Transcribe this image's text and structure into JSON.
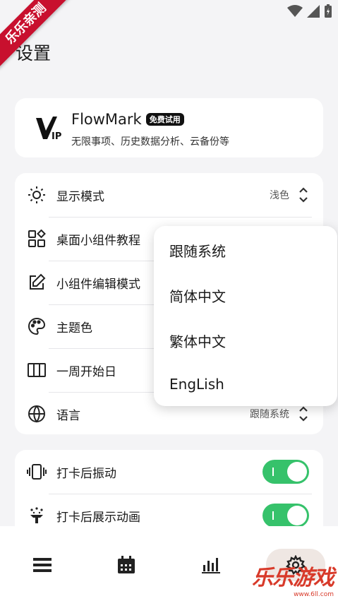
{
  "watermark": {
    "ribbon": "乐乐亲测",
    "corner_title": "乐乐游戏",
    "corner_url": "www.6ll.com"
  },
  "page": {
    "title": "设置"
  },
  "vip": {
    "name": "FlowMark",
    "badge": "免费试用",
    "desc": "无限事项、历史数据分析、云备份等",
    "logo_text": "VIP"
  },
  "settings": {
    "rows": [
      {
        "label": "显示模式",
        "value": "浅色",
        "icon": "sun-icon"
      },
      {
        "label": "桌面小组件教程",
        "icon": "widgets-icon"
      },
      {
        "label": "小组件编辑模式",
        "icon": "edit-icon"
      },
      {
        "label": "主题色",
        "icon": "palette-icon"
      },
      {
        "label": "一周开始日",
        "icon": "columns-icon"
      },
      {
        "label": "语言",
        "value": "跟随系统",
        "icon": "globe-icon"
      }
    ]
  },
  "language_menu": {
    "options": [
      "跟随系统",
      "简体中文",
      "繁体中文",
      "EngLish"
    ]
  },
  "toggles": [
    {
      "label": "打卡后振动",
      "on": true,
      "icon": "vibrate-icon"
    },
    {
      "label": "打卡后展示动画",
      "on": true,
      "icon": "celebrate-icon"
    }
  ],
  "nav": {
    "items": [
      "list-icon",
      "calendar-icon",
      "chart-icon",
      "gear-icon"
    ],
    "active": "gear-icon"
  },
  "colors": {
    "accent_green": "#36c26b",
    "nav_active_bg": "#efe7e3",
    "watermark_red": "#c8102e"
  }
}
